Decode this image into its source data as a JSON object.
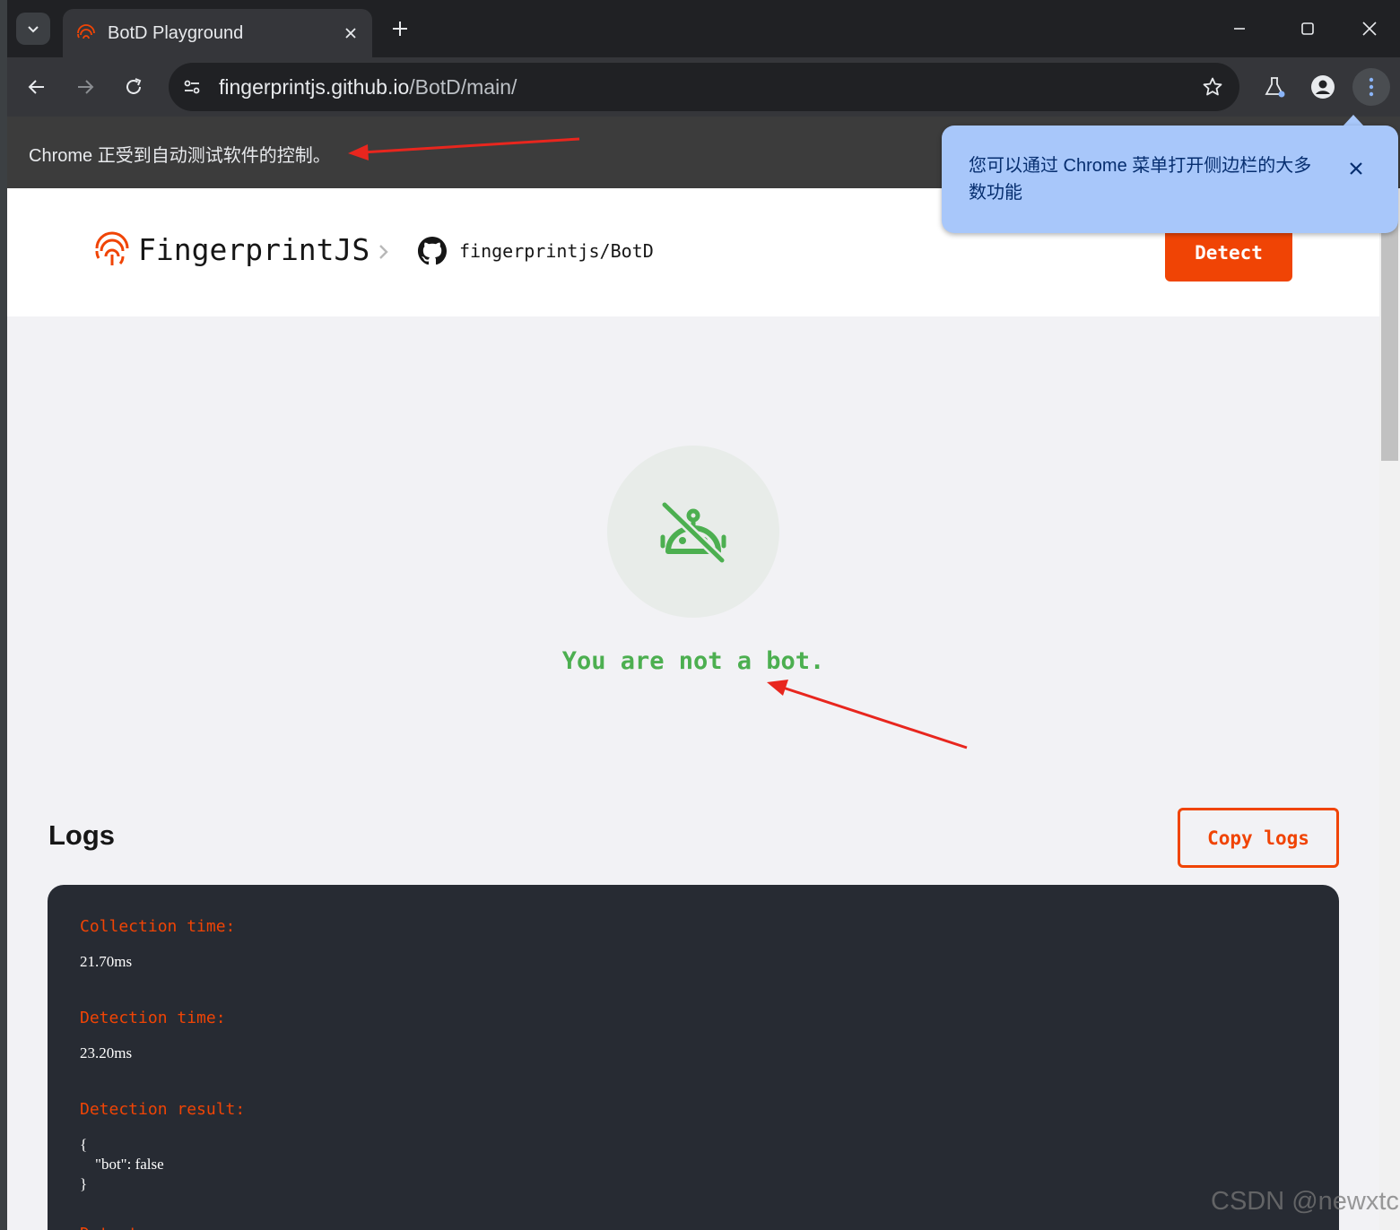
{
  "browser": {
    "tab": {
      "title": "BotD Playground",
      "close_label": "×"
    },
    "new_tab_label": "+",
    "window_controls": [
      "minimize",
      "maximize",
      "close"
    ],
    "address": {
      "host": "fingerprintjs.github.io",
      "path": "/BotD/main/"
    },
    "infobar": {
      "message": "Chrome 正受到自动测试软件的控制。"
    },
    "tooltip": {
      "message": "您可以通过 Chrome 菜单打开侧边栏的大多数功能"
    }
  },
  "site": {
    "logo_text": "FingerprintJS",
    "repo_link": "fingerprintjs/BotD",
    "detect_label": "Detect"
  },
  "result": {
    "message": "You are not a bot.",
    "status_color": "#4caf50"
  },
  "logs": {
    "title": "Logs",
    "copy_label": "Copy logs",
    "entries": [
      {
        "key": "Collection time:",
        "value": "21.70ms"
      },
      {
        "key": "Detection time:",
        "value": "23.20ms"
      },
      {
        "key": "Detection result:",
        "value": "{\n    \"bot\": false\n}"
      },
      {
        "key": "Detectors:",
        "value": ""
      }
    ]
  },
  "colors": {
    "accent": "#f04405",
    "success": "#4caf50",
    "logs_bg": "#272b33",
    "tooltip_bg": "#a8c7fa"
  },
  "watermark": "CSDN @newxtc"
}
